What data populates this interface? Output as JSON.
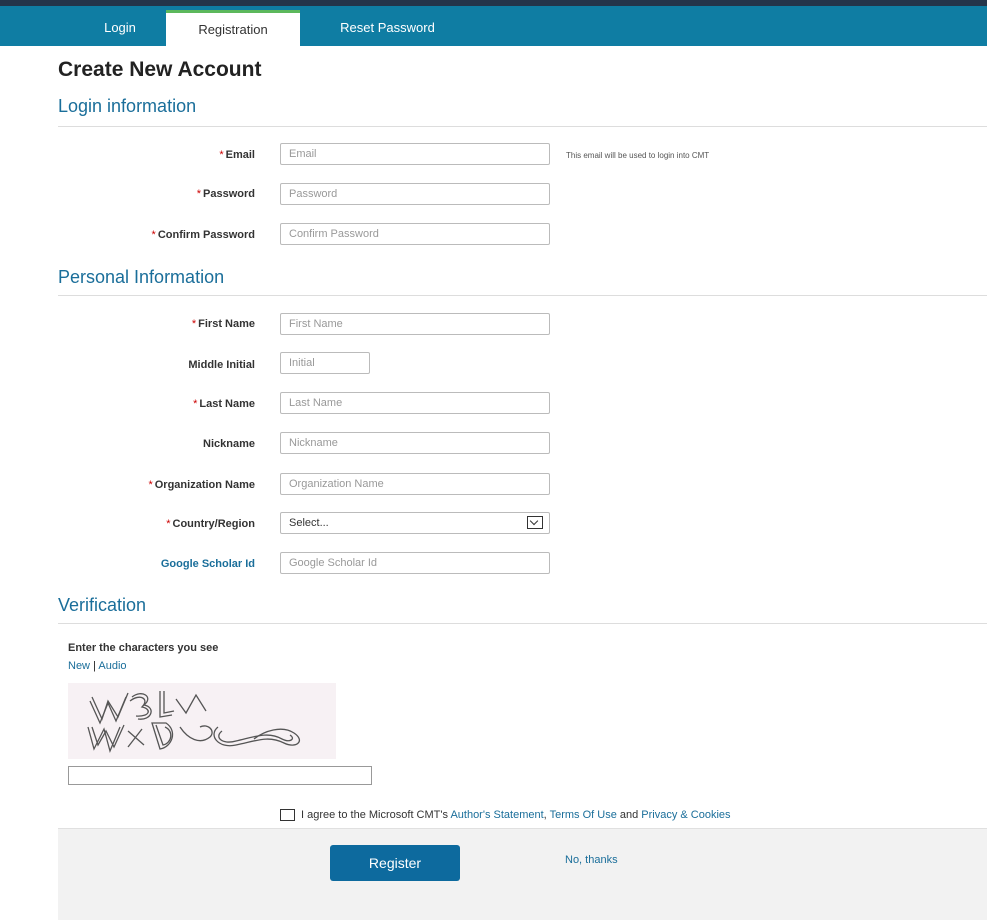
{
  "tabs": [
    "Login",
    "Registration",
    "Reset Password"
  ],
  "page_title": "Create New Account",
  "sections": {
    "login": "Login information",
    "personal": "Personal Information",
    "verification": "Verification"
  },
  "required_marker": "*",
  "fields": {
    "email": {
      "label": "Email",
      "placeholder": "Email",
      "note": "This email will be used to login into CMT"
    },
    "password": {
      "label": "Password",
      "placeholder": "Password"
    },
    "confirm_password": {
      "label": "Confirm Password",
      "placeholder": "Confirm Password"
    },
    "first_name": {
      "label": "First Name",
      "placeholder": "First Name"
    },
    "middle_initial": {
      "label": "Middle Initial",
      "placeholder": "Initial"
    },
    "last_name": {
      "label": "Last Name",
      "placeholder": "Last Name"
    },
    "nickname": {
      "label": "Nickname",
      "placeholder": "Nickname"
    },
    "organization": {
      "label": "Organization Name",
      "placeholder": "Organization Name"
    },
    "country": {
      "label": "Country/Region",
      "value": "Select..."
    },
    "scholar": {
      "label": "Google Scholar Id",
      "placeholder": "Google Scholar Id"
    }
  },
  "verification": {
    "prompt": "Enter the characters you see",
    "new_link": "New",
    "separator": "|",
    "audio_link": "Audio"
  },
  "agree": {
    "prefix": "I agree to the Microsoft CMT's",
    "authors_statement": "Author's Statement",
    "comma": ",",
    "terms": "Terms Of Use",
    "and": "and",
    "privacy": "Privacy & Cookies"
  },
  "footer": {
    "register": "Register",
    "no_thanks": "No, thanks"
  },
  "colors": {
    "topbar": "#0f7da3",
    "accent_link": "#1a6e9a",
    "register_button": "#0d6a9e",
    "required": "#cc0000"
  }
}
